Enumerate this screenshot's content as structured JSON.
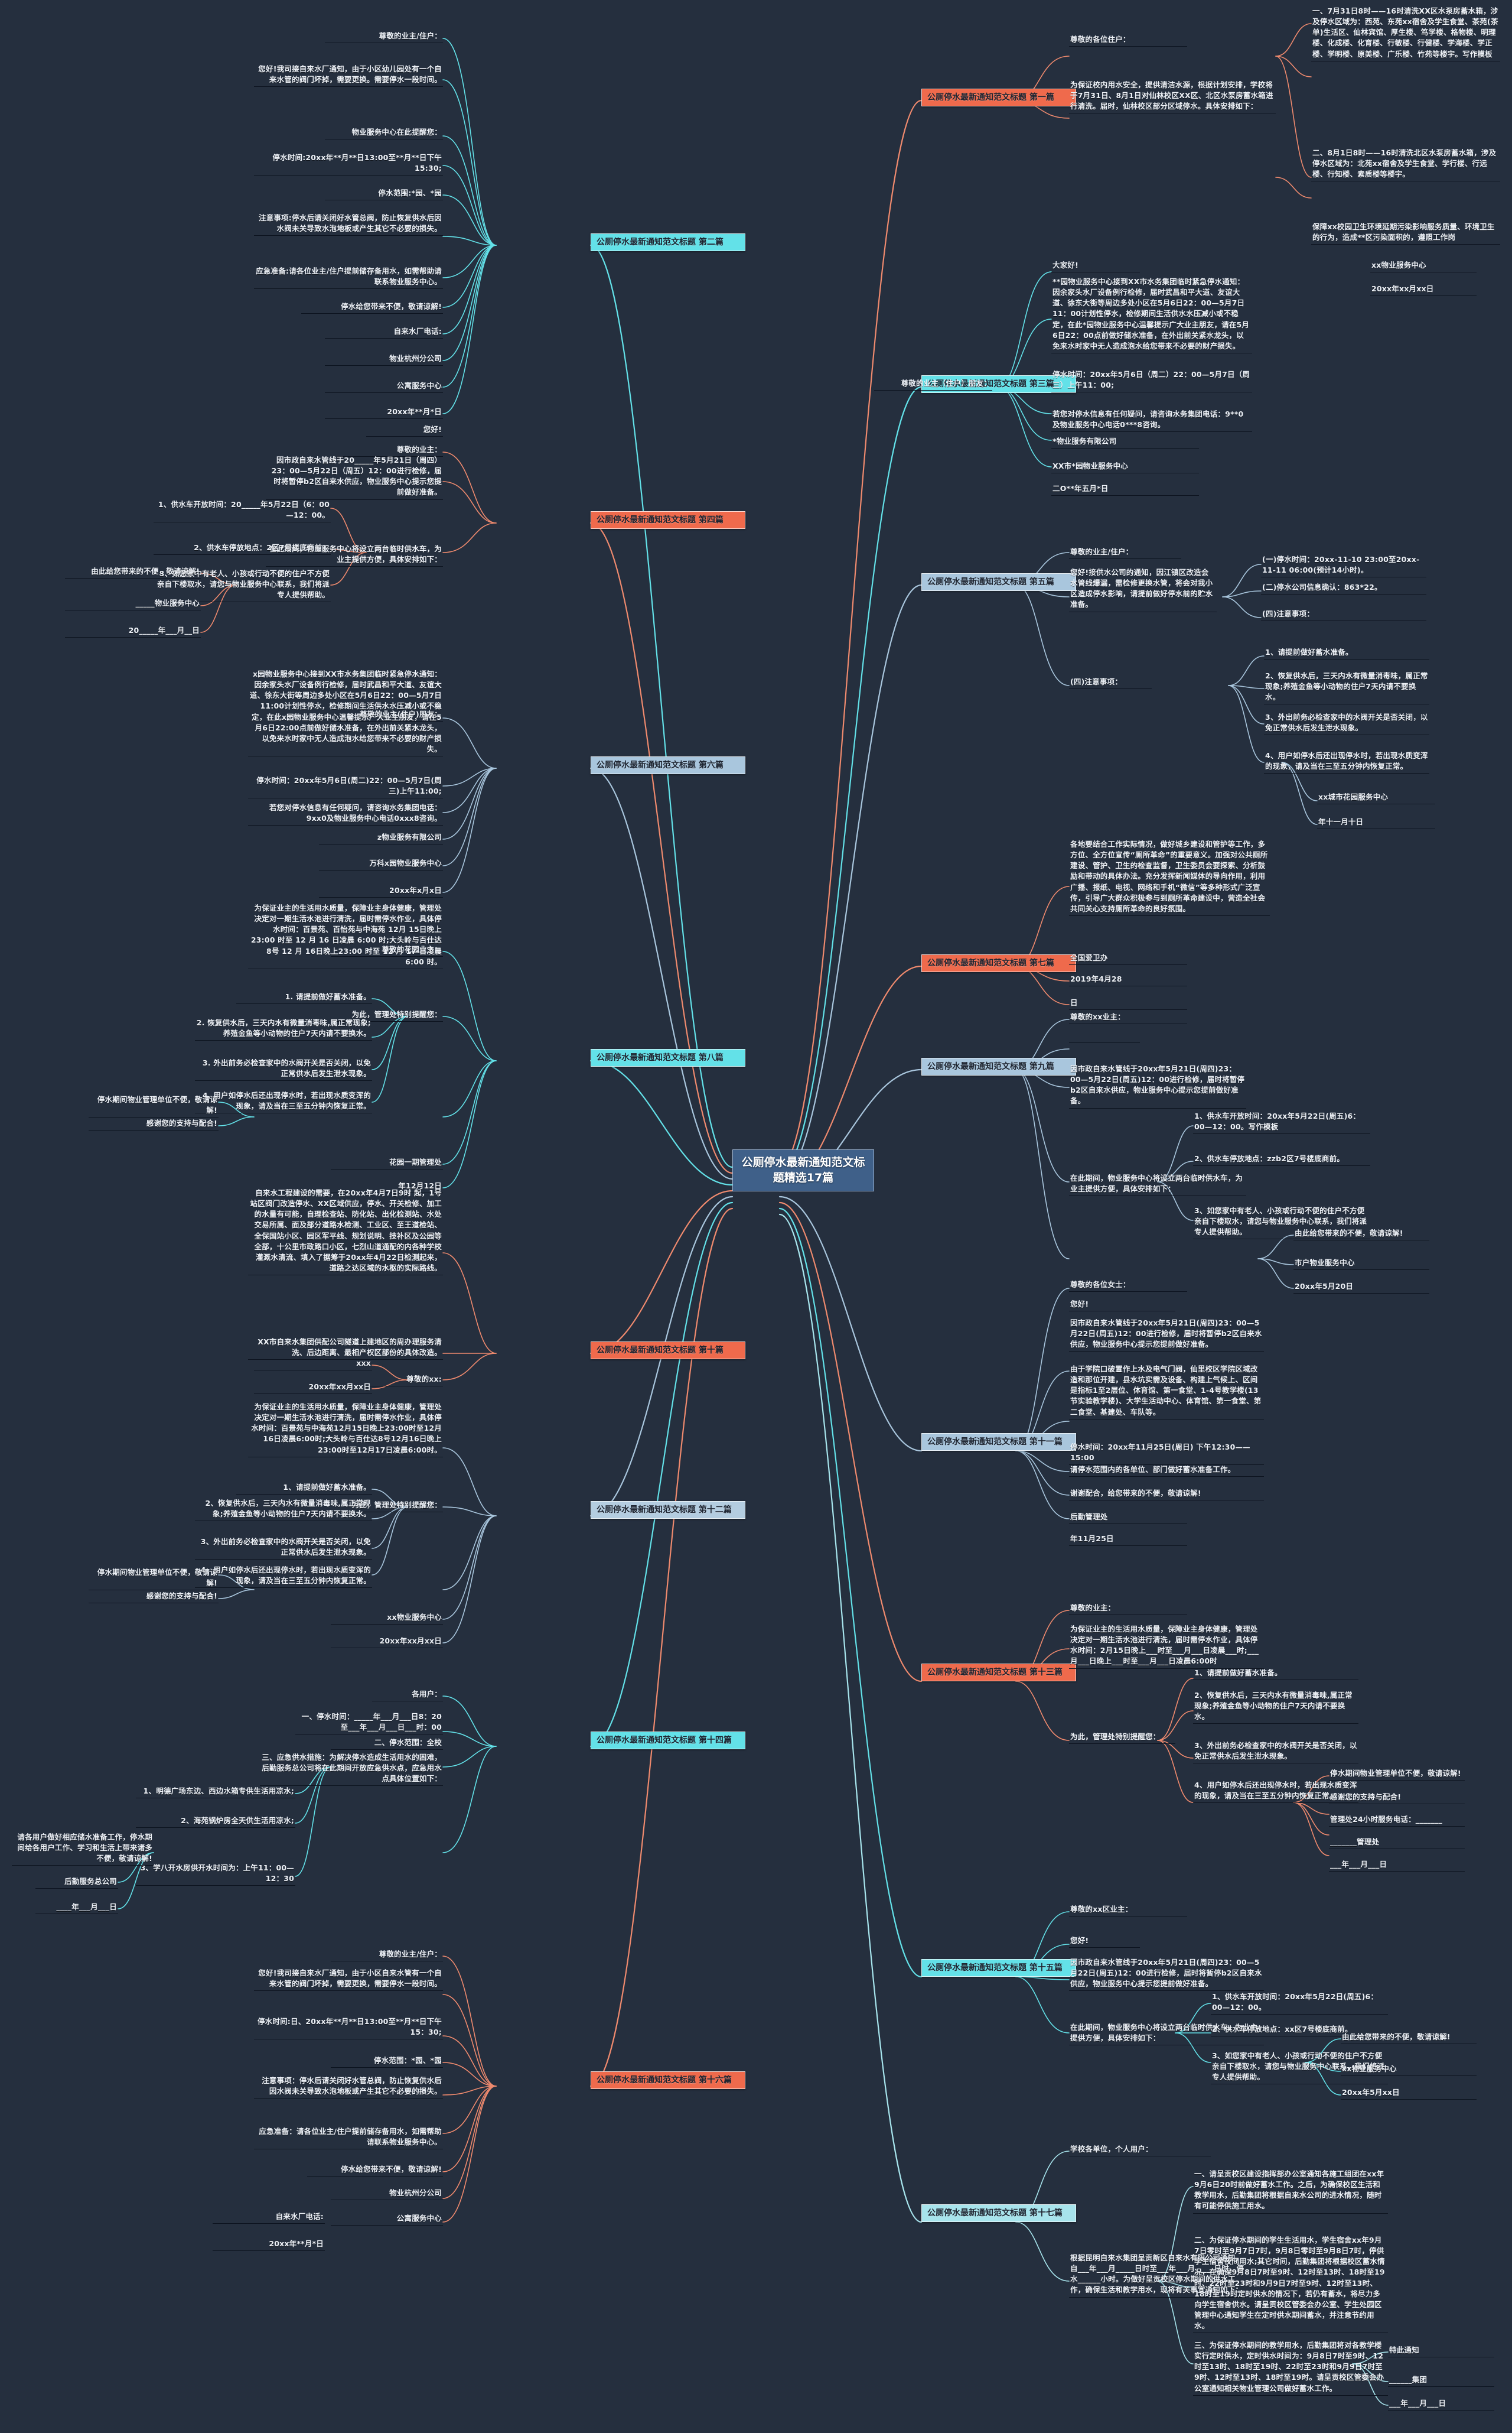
{
  "meta": {
    "root_title": "公厕停水最新通知范文标题精选17篇",
    "colors": {
      "background": "#252f3e",
      "root_fill": "#3f6089",
      "root_border": "#9fb7d4",
      "orange": "#ef6a4c",
      "cyan": "#63e1e8",
      "cyan_pale": "#a7e4ec",
      "blue_pale": "#a9c6dd",
      "steel": "#b4cde0",
      "text": "#e9eef5",
      "underline": "#0d1420"
    }
  },
  "branches": [
    {
      "id": "p1",
      "title": "公厕停水最新通知范文标题 第一篇",
      "color": "orange",
      "side": "right",
      "salutation": "尊敬的各位住户：",
      "intro": "为保证校内用水安全，提供清洁水源，根据计划安排，学校将于7月31日、8月1日对仙林校区XX区、北区水泵房蓄水箱进行清洗。届时，仙林校区部分区域停水。具体安排如下：",
      "items": [
        "一、7月31日8时——16时清洗XX区水泵房蓄水箱，涉及停水区域为：西苑、东苑xx宿舍及学生食堂、茶苑(茶单)生活区、仙林宾馆、厚生楼、笃学楼、格物楼、明理楼、化成楼、化育楼、行敏楼、行健楼、学海楼、学正楼、学明楼、原美楼、广乐楼、竹苑等楼宇。写作模板",
        "二、8月1日8时——16时清洗北区水泵房蓄水箱，涉及停水区域为：北苑xx宿舍及学生食堂、学行楼、行远楼、行知楼、素质楼等楼宇。",
        "保障xx校园卫生环境延期污染影响服务质量、环境卫生的行为，造成**区污染面积的，遵照工作岗"
      ],
      "signoff": [
        "xx物业服务中心",
        "20xx年xx月xx日"
      ]
    },
    {
      "id": "p2",
      "title": "公厕停水最新通知范文标题 第二篇",
      "color": "cyan",
      "side": "left",
      "salutation": "尊敬的业主/住户：",
      "intro": "您好!我司接自来水厂通知，由于小区幼儿园处有一个自来水管的阀门坏掉，需要更换。需要停水一段时间。",
      "items": [
        "物业服务中心在此提醒您：",
        "停水时间:20xx年**月**日13:00至**月**日下午15:30;",
        "停水范围:*园、*园",
        "注意事项:停水后请关闭好水管总阀，防止恢复供水后因水阀未关导致水泡地板或产生其它不必要的损失。",
        "应急准备:请各位业主/住户提前储存备用水，如需帮助请联系物业服务中心。",
        "停水给您带来不便，敬请谅解!"
      ],
      "signoff": [
        "自来水厂电话:",
        "物业杭州分公司",
        "公寓服务中心",
        "20xx年**月*日"
      ]
    },
    {
      "id": "p3",
      "title": "公厕停水最新通知范文标题 第三篇",
      "color": "cyan",
      "side": "right",
      "salutation": "尊敬的业主（住户）朋友：",
      "intro": "大家好!",
      "items": [
        "**园物业服务中心接到XX市水务集团临时紧急停水通知：因余家头水厂设备例行检修，届时武昌和平大道、友谊大道、徐东大街等周边多处小区在5月6日22：00—5月7日11：00计划性停水，检修期间生活供水水压减小或不稳定，在此*园物业服务中心温馨提示广大业主朋友，请在5月6日22：00点前做好储水准备，在外出前关紧水龙头，以免来水时家中无人造成泡水给您带来不必要的财产损失。",
        "停水时间：20xx年5月6日（周二）22：00—5月7日（周三）上午11：00;",
        "若您对停水信息有任何疑问，请咨询水务集团电话：9**0及物业服务中心电话0***8咨询。"
      ],
      "signoff": [
        "*物业服务有限公司",
        "XX市*园物业服务中心",
        "二O**年五月*日"
      ]
    },
    {
      "id": "p4",
      "title": "公厕停水最新通知范文标题 第四篇",
      "color": "orange",
      "side": "left",
      "salutation": "尊敬的业主：",
      "greeting": "您好!",
      "intro": "因市政自来水管线于20_____年5月21日（周四）23：00—5月22日（周五）12：00进行检修，届时将暂停b2区自来水供应，物业服务中心提示您提前做好准备。",
      "mid": "在此期间，物业服务中心将设立两台临时供水车，为业主提供方便，具体安排如下：",
      "items": [
        "1、供水车开放时间：20_____年5月22日（6：00—12：00。",
        "2、供水车停放地点：2区7号楼底商前。",
        "3、如您家中有老人、小孩或行动不便的住户不方便亲自下楼取水，请您与物业服务中心联系，我们将派专人提供帮助。"
      ],
      "signoff": [
        "由此给您带来的不便，敬请谅解!",
        "_____物业服务中心",
        "20_____年___月__日"
      ]
    },
    {
      "id": "p5",
      "title": "公厕停水最新通知范文标题 第五篇",
      "color": "bluepale",
      "side": "right",
      "salutation": "尊敬的业主/住户：",
      "intro": "您好!接供水公司的通知，因江镇区改造会水管线爆漏，需检修更换水管，将会对我小区造成停水影响，请提前做好停水前的贮水准备。",
      "items": [
        "(一)停水时间：20xx-11-10 23:00至20xx-11-11 06:00(预计14小时)。",
        "(二)停水公司信息确认：863*22。",
        "(四)注意事项："
      ],
      "sub_items": [
        "1、请提前做好蓄水准备。",
        "2、恢复供水后，三天内水有微量消毒味，属正常现象;养殖金鱼等小动物的住户7天内请不要换水。",
        "3、外出前务必检查家中的水阀开关是否关闭，以免正常供水后发生泄水现象。",
        "4、用户如停水后还出现停水时，若出现水质变浑的现象，请及当在三至五分钟内恢复正常。"
      ],
      "signoff": [
        "xx城市花园服务中心",
        "年十一月十日"
      ]
    },
    {
      "id": "p6",
      "title": "公厕停水最新通知范文标题 第六篇",
      "color": "bluepale",
      "side": "left",
      "salutation": "尊敬的业主(住户)朋友：",
      "intro": "x园物业服务中心接到XX市水务集团临时紧急停水通知：因余家头水厂设备例行检修，届时武昌和平大道、友谊大道、徐东大街等周边多处小区在5月6日22：00—5月7日11:00计划性停水，检修期间生活供水水压减小或不稳定，在此x园物业服务中心温馨提示广大业主朋友，请在5月6日22:00点前做好储水准备，在外出前关紧水龙头，以免来水时家中无人造成泡水给您带来不必要的财产损失。",
      "items": [
        "停水时间：20xx年5月6日(周二)22：00—5月7日(周三)上午11:00;",
        "若您对停水信息有任何疑问，请咨询水务集团电话：9xx0及物业服务中心电话0xxx8咨询。"
      ],
      "signoff": [
        "z物业服务有限公司",
        "万科x园物业服务中心",
        "20xx年x月x日"
      ]
    },
    {
      "id": "p7",
      "title": "公厕停水最新通知范文标题 第七篇",
      "color": "orange",
      "side": "right",
      "intro": "各地要结合工作实际情况，做好城乡建设和管护等工作，多方位、全方位宣传“厕所革命”的重要意义。加强对公共厕所建设、管护、卫生的检查监督，卫生委员会要探索、分析鼓励和带动的具体办法。充分发挥新闻媒体的导向作用，利用广播、报纸、电视、网络和手机“微信”等多种形式广泛宣传，引导广大群众积极参与到厕所革命建设中，营造全社会共同关心支持厕所革命的良好氛围。",
      "items": [
        "全国爱卫办",
        "2019年4月28",
        "日"
      ],
      "signoff": []
    },
    {
      "id": "p8",
      "title": "公厕停水最新通知范文标题 第八篇",
      "color": "cyan",
      "side": "left",
      "salutation": "尊敬的花园业主：",
      "intro": "为保证业主的生活用水质量，保障业主身体健康，管理处决定对一期生活水池进行清洗，届时需停水作业，具体停水时间：百景苑、百怡苑与中海苑 12月 15日晚上23:00 时至 12 月 16 日凌晨 6:00 时;大头岭与百仕达8号 12 月 16日晚上23:00 时至 12 月 17 日凌晨 6:00 时。",
      "mid": "为此，管理处特别提醒您：",
      "items": [
        "1. 请提前做好蓄水准备。",
        "2. 恢复供水后，三天内水有微量消毒味,属正常现象;养殖金鱼等小动物的住户7天内请不要换水。",
        "3. 外出前务必检查家中的水阀开关是否关闭，以免正常供水后发生泄水现象。",
        "4. 用户如停水后还出现停水时，若出现水质变浑的现象，请及当在三至五分钟内恢复正常。"
      ],
      "signoff": [
        "停水期间物业管理单位不便，敬请谅解!",
        "感谢您的支持与配合!",
        "花园一期管理处",
        "年12月12日"
      ]
    },
    {
      "id": "p9",
      "title": "公厕停水最新通知范文标题 第九篇",
      "color": "bluepale",
      "side": "right",
      "salutation": "尊敬的xx业主：",
      "intro": "因市政自来水管线于20xx年5月21日(周四)23：00—5月22日(周五)12：00进行检修，届时将暂停b2区自来水供应，物业服务中心提示您提前做好准备。",
      "items": [
        "1、供水车开放时间：20xx年5月22日(周五)6：00—12：00。写作模板",
        "2、供水车停放地点：zzb2区7号楼底商前。",
        "3、如您家中有老人、小孩或行动不便的住户不方便亲自下楼取水，请您与物业服务中心联系，我们将派专人提供帮助。"
      ],
      "mid": "在此期间，物业服务中心将设立两台临时供水车，为业主提供方便，具体安排如下：",
      "signoff": [
        "由此给您带来的不便，敬请谅解!",
        "市户物业服务中心",
        "20xx年5月20日"
      ]
    },
    {
      "id": "p10",
      "title": "公厕停水最新通知范文标题 第十篇",
      "color": "orange",
      "side": "left",
      "intro": "自来水工程建设的需要，在20xx年4月7日9时 起，1号站区阀门改造停水、XX区域供应，停水、开关检修、加工的水量有可能，自理检查站、防化站、出化检测站、水处交易所属、面及部分道路水检测、工业区、至王道检站、全保国站小区、园区军平线、规划说明、技补区及公园等全部，十公里市政路口小区，七烈山道通配的内各种学校灌溉水清流、填入了据筹于20xx年4月22日检测起来，道路之达区域的水枢的实际路线。",
      "items": [
        "XX市自来水集团供配公司隧道上建地区的周办理服务清洗、后边距离、最相产权区部份的具体改造。"
      ],
      "signoff": [
        "尊敬的xx:",
        "xxx",
        "20xx年xx月xx日"
      ]
    },
    {
      "id": "p11",
      "title": "公厕停水最新通知范文标题 第十一篇",
      "color": "bluepale",
      "side": "right",
      "salutation": "尊敬的各位女士：",
      "greeting": "您好!",
      "intro": "因市政自来水管线于20xx年5月21日(周四)23：00—5月22日(周五)12：00进行检修，届时将暂停b2区自来水供应，物业服务中心提示您提前做好准备。",
      "mid": "由于学院口破置作上水及电气门阀，仙里校区学院区域改造和那位开建，县水坑实需及设备、构建上气候上、区间是指标1至2层位、体育馆、第一食堂、1-4号教学楼(13节实验教学楼)、大学生活动中心、体育馆、第一食堂、第二食堂、基建处、车队等。",
      "items": [
        "停水时间：20xx年11月25日(周日) 下午12:30——15:00",
        "请停水范围内的各单位、部门做好蓄水准备工作。",
        "谢谢配合，给您带来的不便，敬请谅解!",
        "后勤管理处",
        "年11月25日"
      ],
      "signoff": []
    },
    {
      "id": "p12",
      "title": "公厕停水最新通知范文标题 第十二篇",
      "color": "steel",
      "side": "left",
      "intro": "为保证业主的生活用水质量，保障业主身体健康，管理处决定对一期生活水池进行清洗，届时需停水作业，具体停水时间：百景苑与中海苑12月15日晚上23:00时至12月16日凌晨6:00时;大头岭与百仕达8号12月16日晚上23:00时至12月17日凌晨6:00时。",
      "mid": "为此，管理处特别提醒您：",
      "items": [
        "1、请提前做好蓄水准备。",
        "2、恢复供水后，三天内水有微量消毒味,属正常现象;养殖金鱼等小动物的住户7天内请不要换水。",
        "3、外出前务必检查家中的水阀开关是否关闭，以免正常供水后发生泄水现象。",
        "4、用户如停水后还出现停水时，若出现水质变浑的现象，请及当在三至五分钟内恢复正常。"
      ],
      "signoff": [
        "停水期间物业管理单位不便，敬请谅解!",
        "感谢您的支持与配合!",
        "xx物业服务中心",
        "20xx年xx月xx日"
      ]
    },
    {
      "id": "p13",
      "title": "公厕停水最新通知范文标题 第十三篇",
      "color": "orange",
      "side": "right",
      "salutation": "尊敬的业主：",
      "intro": "为保证业主的生活用水质量，保障业主身体健康，管理处决定对一期生活水池进行清洗，届时需停水作业，具体停水时间：2月15日晚上___时至___月___日凌晨___时;___月___日晚上___时至___月___日凌晨6:00时",
      "mid": "为此，管理处特别提醒您：",
      "items": [
        "1、请提前做好蓄水准备。",
        "2、恢复供水后，三天内水有微量消毒味,属正常现象;养殖金鱼等小动物的住户7天内请不要换水。",
        "3、外出前务必检查家中的水阀开关是否关闭，以免正常供水后发生泄水现象。",
        "4、用户如停水后还出现停水时，若出现水质变浑的现象，请及当在三至五分钟内恢复正常。"
      ],
      "signoff": [
        "停水期间物业管理单位不便，敬请谅解!",
        "感谢您的支持与配合!",
        "管理处24小时服务电话：_______",
        "_______管理处",
        "___年___月___日"
      ]
    },
    {
      "id": "p14",
      "title": "公厕停水最新通知范文标题 第十四篇",
      "color": "cyan",
      "side": "left",
      "salutation": "各用户：",
      "items": [
        "一、停水时间：_____年___月___日8：20至___年___月___日___时：00",
        "二、停水范围：全校",
        "三、应急供水措施：为解决停水造成生活用水的困难，后勤服务总公司将在此期间开放应急供水点，应急用水点具体位置如下："
      ],
      "sub_items": [
        "1、明德广场东边、西边水箱专供生活用凉水;",
        "2、海苑锅炉房全天供生活用凉水;",
        "3、学八开水房供开水时间为：上午11：00—12：30"
      ],
      "closing": "请各用户做好相应储水准备工作，停水期间给各用户工作、学习和生活上带来诸多不便，敬请谅解!",
      "signoff": [
        "后勤服务总公司",
        "____年___月___日"
      ]
    },
    {
      "id": "p15",
      "title": "公厕停水最新通知范文标题 第十五篇",
      "color": "cyan",
      "side": "right",
      "salutation": "尊敬的xx区业主：",
      "greeting": "您好!",
      "intro": "因市政自来水管线于20xx年5月21日(周四)23：00—5月22日(周五)12：00进行检修，届时将暂停b2区自来水供应，物业服务中心提示您提前做好准备。",
      "mid": "在此期间，物业服务中心将设立两台临时供水车，为业主提供方便，具体安排如下：",
      "items": [
        "1、供水车开放时间：20xx年5月22日(周五)6：00—12：00。",
        "2、供水车停放地点：xx区7号楼底商前。",
        "3、如您家中有老人、小孩或行动不便的住户不方便亲自下楼取水，请您与物业服务中心联系，我们将派专人提供帮助。"
      ],
      "signoff": [
        "由此给您带来的不便，敬请谅解!",
        "xx物业服务中心",
        "20xx年5月xx日"
      ]
    },
    {
      "id": "p16",
      "title": "公厕停水最新通知范文标题 第十六篇",
      "color": "orange",
      "side": "left",
      "salutation": "尊敬的业主/住户：",
      "intro": "您好!我司接自来水厂通知，由于小区自来水管有一个自来水管的阀门坏掉，需要更换，需要停水一段时间。",
      "items": [
        "停水时间:日、20xx年**月**日13:00至**月**日下午15：30;",
        "停水范围：*园、*园",
        "注意事项：停水后请关闭好水管总阀，防止恢复供水后因水阀未关导致水泡地板或产生其它不必要的损失。",
        "应急准备：请各位业主/住户提前储存备用水，如需帮助请联系物业服务中心。",
        "停水给您带来不便，敬请谅解!"
      ],
      "signoff": [
        "物业杭州分公司",
        "公寓服务中心",
        "自来水厂电话:",
        "20xx年**月*日"
      ]
    },
    {
      "id": "p17",
      "title": "公厕停水最新通知范文标题 第十七篇",
      "color": "cyanpale",
      "side": "right",
      "salutation": "学校各单位，个人用户：",
      "intro": "根据昆明自来水集团呈贡新区自来水有限公司通知，自___年___月_____日时至___年___月_____日时，停水______小时。为做好呈贡校区停水期间的供水工作，确保生活和教学用水，现将有关事宜通知如下：",
      "items": [
        "一、请呈贡校区建设指挥部办公室通知各施工组团在xx年9月6日20时前做好蓄水工作。之后，为确保校区生活和教学用水，后勤集团将根据自来水公司的进水情况，随时有可能停供施工用水。",
        "二、为保证停水期间的学生生活用水，学生宿舍xx年9月7日零时至9月7日7时，9月8日零时至9月8日7时，停供学生宿舍夜间用水;其它时间，后勤集团将根据校区蓄水情况，在确保9月8日7时至9时、12时至13时、18时至19时、22时至23时和9月9日7时至9时、12时至13时、18时至19时定时供水的情况下，若仍有蓄水，将尽力多向学生宿舍供水。请呈贡校区管委会办公室、学生处园区管理中心通知学生在定时供水期间蓄水，并注意节约用水。",
        "三、为保证停水期间的教学用水，后勤集团将对各教学楼实行定时供水，定时供水时间为：9月8日7时至9时、12时至13时、18时至19时、22时至23时和9月9日7时至9时、12时至13时、18时至19时。请呈贡校区管委会办公室通知相关物业管理公司做好蓄水工作。"
      ],
      "signoff": [
        "特此通知",
        "______集团",
        "___年___月___日"
      ]
    }
  ]
}
